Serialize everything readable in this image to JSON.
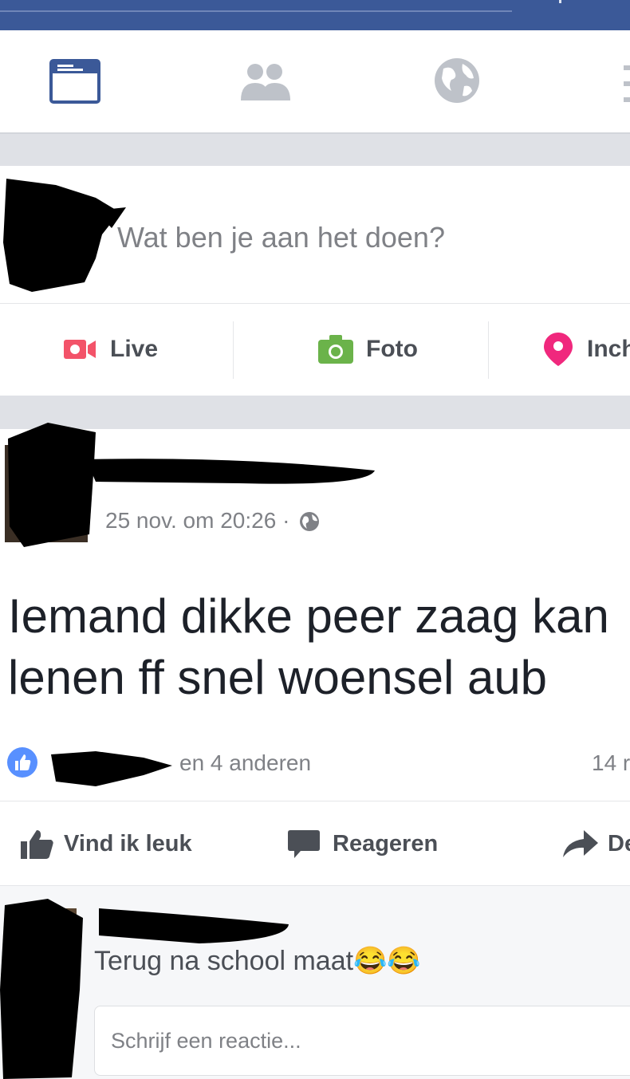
{
  "nav": {
    "icons": [
      "news-feed-icon",
      "friends-icon",
      "globe-icon",
      "more-icon"
    ]
  },
  "composer": {
    "placeholder": "Wat ben je aan het doen?",
    "actions": [
      {
        "icon": "video-camera-icon",
        "label": "Live",
        "color": "#f35369"
      },
      {
        "icon": "camera-icon",
        "label": "Foto",
        "color": "#6bb34a"
      },
      {
        "icon": "location-pin-icon",
        "label": "Inch",
        "color": "#f0287d"
      }
    ]
  },
  "post": {
    "timestamp": "25 nov. om 20:26 ·",
    "text_line1": "Iemand dikke peer zaag kan",
    "text_line2": "lenen ff snel woensel aub",
    "reactions_text": "en 4 anderen",
    "count": "14 r",
    "buttons": {
      "like": "Vind ik leuk",
      "comment": "Reageren",
      "share": "De"
    }
  },
  "comment": {
    "text": "Terug na school maat😂😂",
    "reply_placeholder": "Schrijf een reactie..."
  },
  "colors": {
    "brand_blue": "#3b5998",
    "like_blue": "#5890ff",
    "separator": "#dfe1e6"
  }
}
